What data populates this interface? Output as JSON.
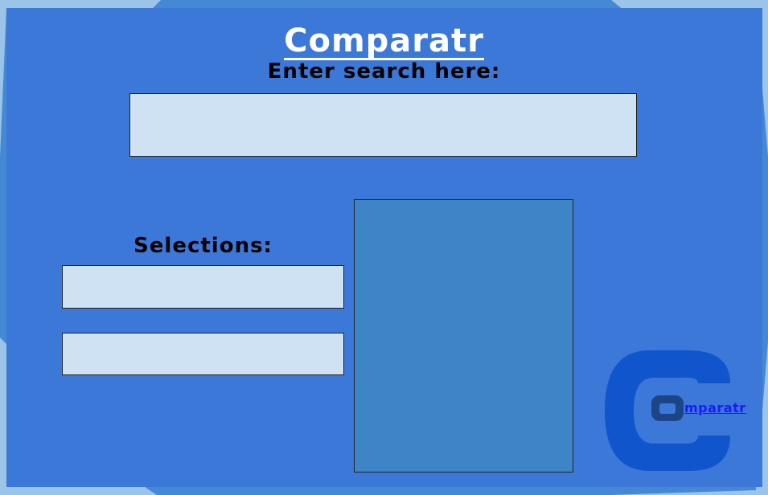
{
  "app": {
    "title": "Comparatr"
  },
  "search": {
    "label": "Enter search here:",
    "value": "",
    "placeholder": ""
  },
  "selections": {
    "label": "Selections:",
    "items": [
      "",
      ""
    ]
  },
  "logo": {
    "link_text": "mparatr",
    "icon": "c-logo-icon"
  },
  "colors": {
    "panel": "#3c78d8",
    "frame": "#9cc4e8",
    "input_bg": "#cfe2f3",
    "results_bg": "#3d85c6",
    "logo": "#1155cc"
  }
}
